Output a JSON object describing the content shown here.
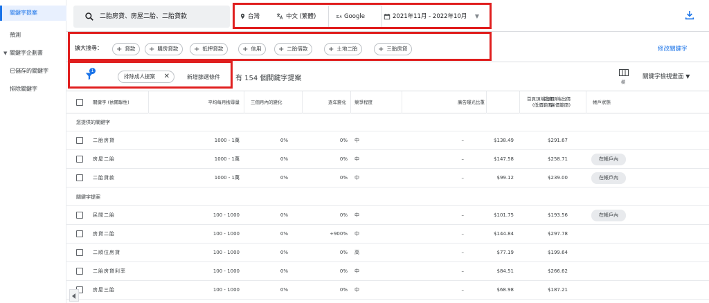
{
  "sidebar": {
    "items": [
      {
        "label": "關鍵字提案",
        "active": true
      },
      {
        "label": "預測"
      },
      {
        "label": "關鍵字企劃書",
        "expandable": true
      },
      {
        "label": "已儲存的關鍵字"
      },
      {
        "label": "排除關鍵字"
      }
    ]
  },
  "search": {
    "query": "二胎房貸、房屋二胎、二胎貸款",
    "location": "台灣",
    "language": "中文 (繁體)",
    "network": "Google",
    "date_range": "2021年11月 - 2022年10月"
  },
  "expand": {
    "label": "擴大搜尋：",
    "chips": [
      "貸款",
      "購房貸款",
      "抵押貸款",
      "信用",
      "二胎借款",
      "土地二胎",
      "三胎房貸"
    ],
    "edit_link": "修改關鍵字"
  },
  "filters": {
    "badge_count": "1",
    "active_filter": "排除成人提案",
    "add_filter": "新增篩選條件",
    "result_count": "有 154 個關鍵字提案",
    "columns_label": "欄",
    "view_label": "關鍵字檢視畫面"
  },
  "table": {
    "headers": {
      "keyword": "關鍵字 (依關聯性)",
      "monthly": "平均每月搜尋量",
      "three_month": "三個月內的變化",
      "yoy": "逐年變化",
      "competition": "競爭程度",
      "impression_share": "廣告曝光比重",
      "bid_low_1": "首頁頂端出價",
      "bid_low_2": "(低價範圍)",
      "bid_high_1": "首頁頂端出價",
      "bid_high_2": "(高價範圍)",
      "account_status": "帳戶狀態"
    },
    "sections": [
      {
        "title": "您提供的關鍵字"
      },
      {
        "title": "關鍵字提案"
      }
    ],
    "provided_rows": [
      {
        "keyword": "二胎房貸",
        "monthly": "1000 - 1萬",
        "three_month": "0%",
        "yoy": "0%",
        "competition": "中",
        "impression": "–",
        "bid_low": "$138.49",
        "bid_high": "$291.67",
        "status": ""
      },
      {
        "keyword": "房屋二胎",
        "monthly": "1000 - 1萬",
        "three_month": "0%",
        "yoy": "0%",
        "competition": "中",
        "impression": "–",
        "bid_low": "$147.58",
        "bid_high": "$258.71",
        "status": "在帳戶內"
      },
      {
        "keyword": "二胎貸款",
        "monthly": "1000 - 1萬",
        "three_month": "0%",
        "yoy": "0%",
        "competition": "中",
        "impression": "–",
        "bid_low": "$99.12",
        "bid_high": "$239.00",
        "status": "在帳戶內"
      }
    ],
    "idea_rows": [
      {
        "keyword": "民間二胎",
        "monthly": "100 - 1000",
        "three_month": "0%",
        "yoy": "0%",
        "competition": "中",
        "impression": "–",
        "bid_low": "$101.75",
        "bid_high": "$193.56",
        "status": "在帳戶內"
      },
      {
        "keyword": "房貸二胎",
        "monthly": "100 - 1000",
        "three_month": "0%",
        "yoy": "+900%",
        "competition": "中",
        "impression": "–",
        "bid_low": "$144.84",
        "bid_high": "$297.78",
        "status": ""
      },
      {
        "keyword": "二順位房貸",
        "monthly": "100 - 1000",
        "three_month": "0%",
        "yoy": "0%",
        "competition": "高",
        "impression": "–",
        "bid_low": "$77.19",
        "bid_high": "$199.64",
        "status": ""
      },
      {
        "keyword": "二胎房貸利率",
        "monthly": "100 - 1000",
        "three_month": "0%",
        "yoy": "0%",
        "competition": "中",
        "impression": "–",
        "bid_low": "$84.51",
        "bid_high": "$266.62",
        "status": ""
      },
      {
        "keyword": "房屋三胎",
        "monthly": "100 - 1000",
        "three_month": "0%",
        "yoy": "0%",
        "competition": "中",
        "impression": "–",
        "bid_low": "$68.98",
        "bid_high": "$187.21",
        "status": ""
      }
    ]
  },
  "colors": {
    "accent": "#1a73e8",
    "highlight": "#e01e1e"
  }
}
